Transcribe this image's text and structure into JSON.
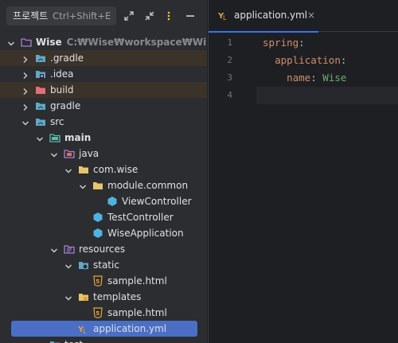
{
  "project_panel": {
    "title": "프로젝트",
    "shortcut": "Ctrl+Shift+E"
  },
  "tree": [
    {
      "label": "Wise",
      "path": "C:₩Wise₩workspace₩Wise",
      "depth": 0,
      "arrow": "down",
      "icon": "module-folder-icon",
      "bold": true
    },
    {
      "label": ".gradle",
      "depth": 1,
      "arrow": "right",
      "icon": "folder-icon",
      "excluded": true
    },
    {
      "label": ".idea",
      "depth": 1,
      "arrow": "right",
      "icon": "idea-folder-icon"
    },
    {
      "label": "build",
      "depth": 1,
      "arrow": "right",
      "icon": "excluded-folder-icon",
      "excluded": true
    },
    {
      "label": "gradle",
      "depth": 1,
      "arrow": "right",
      "icon": "folder-icon"
    },
    {
      "label": "src",
      "depth": 1,
      "arrow": "down",
      "icon": "folder-icon"
    },
    {
      "label": "main",
      "depth": 2,
      "arrow": "down",
      "icon": "source-root-icon",
      "bold": true
    },
    {
      "label": "java",
      "depth": 3,
      "arrow": "down",
      "icon": "java-source-folder-icon"
    },
    {
      "label": "com.wise",
      "depth": 4,
      "arrow": "down",
      "icon": "package-icon"
    },
    {
      "label": "module.common",
      "depth": 5,
      "arrow": "down",
      "icon": "package-icon"
    },
    {
      "label": "ViewController",
      "depth": 6,
      "arrow": "none",
      "icon": "spring-bean-icon"
    },
    {
      "label": "TestController",
      "depth": 5,
      "arrow": "none",
      "icon": "spring-bean-icon"
    },
    {
      "label": "WiseApplication",
      "depth": 5,
      "arrow": "none",
      "icon": "spring-bean-icon"
    },
    {
      "label": "resources",
      "depth": 3,
      "arrow": "down",
      "icon": "resources-folder-icon"
    },
    {
      "label": "static",
      "depth": 4,
      "arrow": "down",
      "icon": "web-folder-icon"
    },
    {
      "label": "sample.html",
      "depth": 5,
      "arrow": "none",
      "icon": "html-file-icon"
    },
    {
      "label": "templates",
      "depth": 4,
      "arrow": "down",
      "icon": "templates-folder-icon"
    },
    {
      "label": "sample.html",
      "depth": 5,
      "arrow": "none",
      "icon": "html-file-icon"
    },
    {
      "label": "application.yml",
      "depth": 4,
      "arrow": "none",
      "icon": "yaml-file-icon",
      "selected": true
    },
    {
      "label": "test",
      "depth": 2,
      "arrow": "right",
      "icon": "folder-icon"
    }
  ],
  "editor": {
    "tab_label": "application.yml",
    "tab_close": "×",
    "line_numbers": [
      "1",
      "2",
      "3",
      "4"
    ],
    "lines": [
      [
        {
          "t": "spring",
          "c": "k"
        },
        {
          "t": ":",
          "c": "pn"
        }
      ],
      [
        {
          "t": "  "
        },
        {
          "t": "application",
          "c": "k"
        },
        {
          "t": ":",
          "c": "pn"
        }
      ],
      [
        {
          "t": "    "
        },
        {
          "t": "name",
          "c": "k"
        },
        {
          "t": ": ",
          "c": "pn"
        },
        {
          "t": "Wise",
          "c": "v"
        }
      ],
      []
    ],
    "current_line": 4
  },
  "colors": {
    "accent": "#3574f0",
    "selection": "#4a6fc4",
    "excluded_row": "#3b3229",
    "panel_bg": "#2b2d30",
    "editor_bg": "#1e1f22"
  }
}
